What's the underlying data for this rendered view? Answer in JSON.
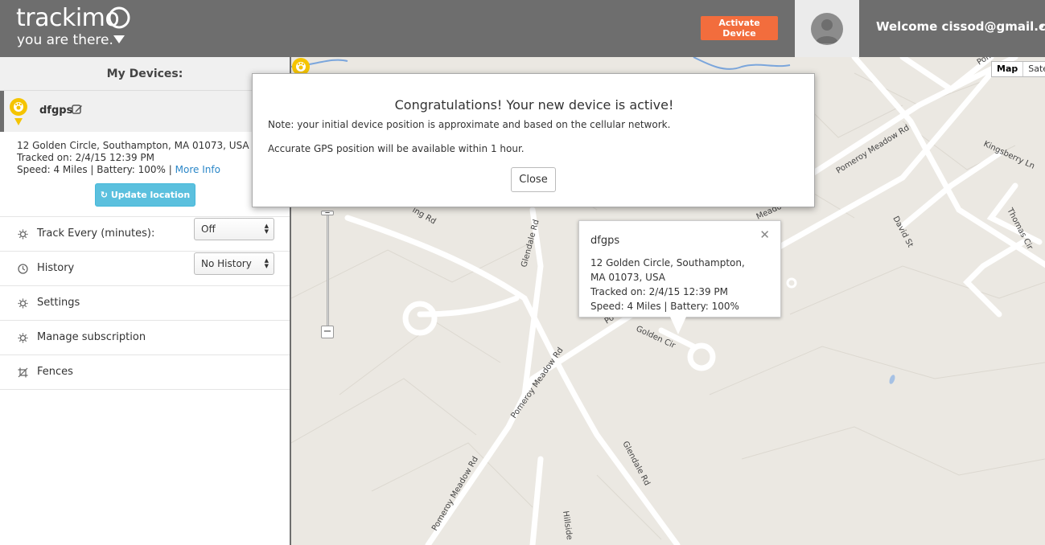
{
  "header": {
    "logo_word": "trackimo",
    "logo_tagline": "you are there.",
    "activate_label": "Activate Device",
    "welcome_text": "Welcome cissod@gmail.com"
  },
  "sidebar": {
    "title": "My Devices:",
    "device": {
      "name": "dfgps",
      "address": "12 Golden Circle, Southampton, MA 01073, USA",
      "tracked": "Tracked on: 2/4/15 12:39 PM",
      "status": "Speed: 4 Miles | Battery: 100% |",
      "more_info": "More Info",
      "update_label": "Update location"
    },
    "menu": [
      {
        "label": "Track Every (minutes):",
        "select": "Off"
      },
      {
        "label": "History",
        "select": "No History"
      },
      {
        "label": "Settings"
      },
      {
        "label": "Manage subscription"
      },
      {
        "label": "Fences"
      }
    ]
  },
  "map": {
    "type_options": [
      "Map",
      "Satel"
    ],
    "roads": [
      "Pomeroy Meadow Rd",
      "Pomeroy Meadow Rd",
      "Pomeroy Meadow Rd",
      "Pomeroy Me",
      "Glendale Rd",
      "Glendale Rd",
      "Golden Cir",
      "David St",
      "Thomas Cir",
      "Kingsberry Ln",
      "ing Rd",
      "Hillside",
      "Meadow",
      "Po"
    ],
    "infowindow": {
      "title": "dfgps",
      "line1": "12 Golden Circle, Southampton,",
      "line2": "MA 01073, USA",
      "line3": "Tracked on: 2/4/15 12:39 PM",
      "line4": "Speed: 4 Miles | Battery: 100%"
    }
  },
  "modal": {
    "title": "Congratulations! Your new device is active!",
    "note": "Note: your initial device position is approximate and based on the cellular network.",
    "note2": "Accurate GPS position will be available within 1 hour.",
    "close_label": "Close"
  },
  "colors": {
    "header_bg": "#6e6e6e",
    "activate": "#f26d3d",
    "update": "#5bc0de",
    "pin": "#f5c400",
    "link": "#2b87c8"
  }
}
